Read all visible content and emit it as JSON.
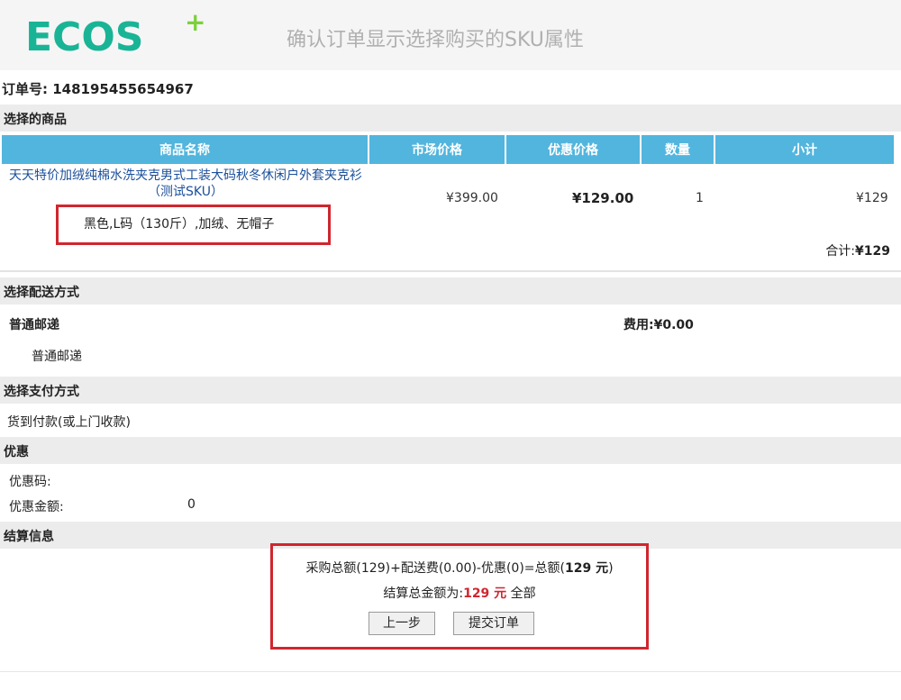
{
  "header": {
    "logo_text": "ECOS",
    "logo_plus": "+",
    "title": "确认订单显示选择购买的SKU属性"
  },
  "order": {
    "label": "订单号:",
    "number": "148195455654967"
  },
  "sections": {
    "goods": "选择的商品",
    "shipping": "选择配送方式",
    "payment": "选择支付方式",
    "discount": "优惠",
    "settlement": "结算信息"
  },
  "goods_table": {
    "headers": [
      "商品名称",
      "市场价格",
      "优惠价格",
      "数量",
      "小计"
    ],
    "row": {
      "name": "天天特价加绒纯棉水洗夹克男式工装大码秋冬休闲户外套夹克衫（测试SKU）",
      "sku": "黑色,L码（130斤）,加绒、无帽子",
      "market_price": "¥399.00",
      "discount_price": "¥129.00",
      "qty": "1",
      "subtotal": "¥129"
    },
    "total_label": "合计:",
    "total_value": "¥129"
  },
  "shipping": {
    "name": "普通邮递",
    "fee_label": "费用:",
    "fee_value": "¥0.00",
    "sub": "普通邮递"
  },
  "payment": {
    "method": "货到付款(或上门收款)"
  },
  "discount": {
    "code_label": "优惠码:",
    "amount_label": "优惠金额:",
    "amount_value": "0"
  },
  "settlement": {
    "formula": "采购总额(129)+配送费(0.00)-优惠(0)=总额(",
    "formula_total": "129 元",
    "formula_end": ")",
    "total_label": "结算总金额为:",
    "total_value": "129 元",
    "total_suffix": " 全部",
    "prev_button": "上一步",
    "submit_button": "提交订单"
  },
  "colors": {
    "accent": "#52b5dd",
    "highlight": "#d0262e",
    "brand": "#19b496"
  }
}
